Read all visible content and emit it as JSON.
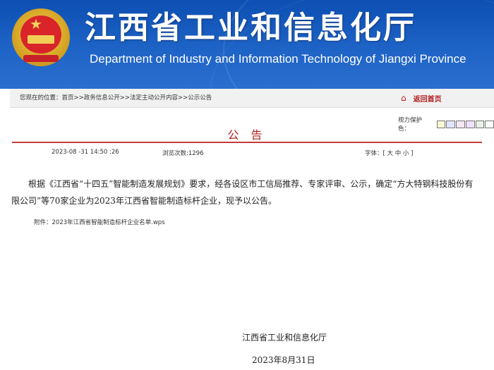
{
  "header": {
    "cn_title": "江西省工业和信息化厅",
    "en_title": "Department of Industry and Information Technology of Jiangxi Province",
    "emblem_icon": "national-emblem-icon"
  },
  "breadcrumb": {
    "text": "您现在的位置：首页>>政务信息公开>>法定主动公开内容>>公示公告"
  },
  "home_link": {
    "label": "返回首页",
    "icon": "home-icon"
  },
  "eye_protection": {
    "label": "视力保护色：",
    "colors": [
      "#fafad2",
      "#dfe6ff",
      "#f5e6f0",
      "#f0e0ff",
      "#e8f0e8",
      "#ffffff"
    ]
  },
  "notice": {
    "title": "公 告",
    "date": "2023-08 -31 14:50 :26",
    "views": "浏览次数:1296",
    "font_size": "字体：[ 大 中 小 ]",
    "body": "根据《江西省“十四五”智能制造发展规划》要求，经各设区市工信局推荐、专家评审、公示，确定“方大特钢科技股份有限公司”等70家企业为2023年江西省智能制造标杆企业，现予以公告。",
    "attachment": "附件：2023年江西省智能制造标杆企业名单.wps",
    "sign_org": "江西省工业和信息化厅",
    "sign_date": "2023年8月31日"
  },
  "colors": {
    "banner": "#1e63c6",
    "title_red": "#b01f1f",
    "rule_red": "#c13b3b"
  }
}
